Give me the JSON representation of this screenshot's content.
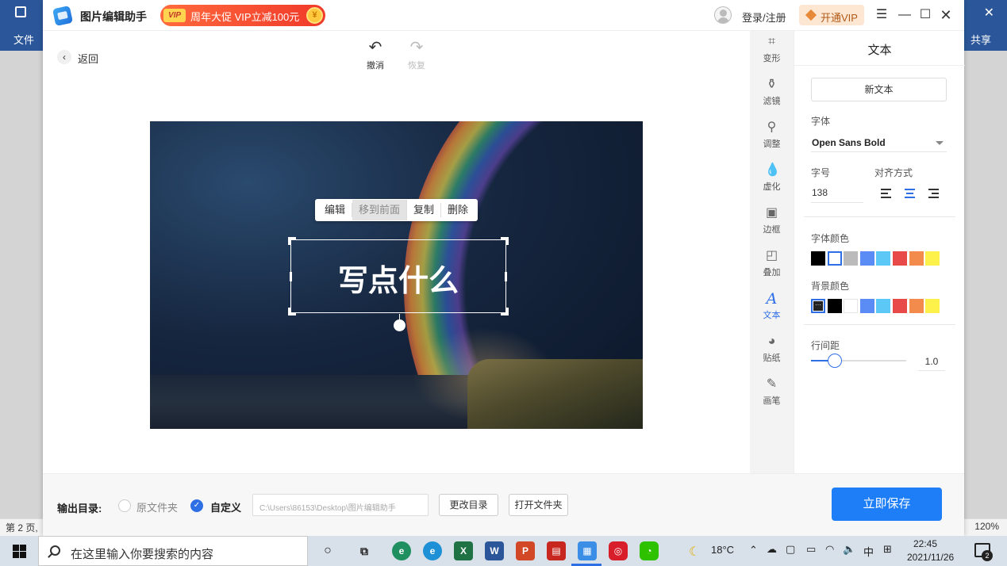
{
  "word": {
    "file_tab": "文件",
    "share_label": "共享",
    "page_status": "第 2 页,",
    "zoom": "120%"
  },
  "titlebar": {
    "app_title": "图片编辑助手",
    "promo_badge": "VIP",
    "promo_text": "周年大促 VIP立减100元",
    "login_label": "登录/注册",
    "vip_button_label": "开通VIP"
  },
  "toolbar": {
    "back_label": "返回",
    "undo_label": "撤消",
    "redo_label": "恢复"
  },
  "canvas": {
    "context_menu": [
      "编辑",
      "移到前面",
      "复制",
      "删除"
    ],
    "text_content": "写点什么"
  },
  "tools": [
    {
      "icon": "crop-icon",
      "label": "变形"
    },
    {
      "icon": "filter-icon",
      "label": "滤镜"
    },
    {
      "icon": "adjust-icon",
      "label": "调整"
    },
    {
      "icon": "blur-icon",
      "label": "虚化"
    },
    {
      "icon": "border-icon",
      "label": "边框"
    },
    {
      "icon": "overlay-icon",
      "label": "叠加"
    },
    {
      "icon": "text-icon",
      "label": "文本",
      "active": true
    },
    {
      "icon": "sticker-icon",
      "label": "贴纸"
    },
    {
      "icon": "brush-icon",
      "label": "画笔"
    }
  ],
  "props": {
    "title": "文本",
    "new_text_button": "新文本",
    "font_label": "字体",
    "font_value": "Open Sans Bold",
    "size_label": "字号",
    "size_value": "138",
    "align_label": "对齐方式",
    "font_color_label": "字体颜色",
    "font_colors": [
      "#000000",
      "#ffffff",
      "#bbbbbb",
      "#5b8cf5",
      "#5bc8f5",
      "#e84a4a",
      "#f28b4b",
      "#fef24a"
    ],
    "bg_color_label": "背景颜色",
    "bg_colors": [
      "#222222",
      "#000000",
      "#ffffff",
      "#5b8cf5",
      "#5bc8f5",
      "#e84a4a",
      "#f28b4b",
      "#fef24a"
    ],
    "line_spacing_label": "行间距",
    "line_spacing_value": "1.0"
  },
  "footer": {
    "output_label": "输出目录:",
    "original_folder_label": "原文件夹",
    "custom_label": "自定义",
    "path_placeholder": "C:\\Users\\86153\\Desktop\\图片编辑助手",
    "change_dir_button": "更改目录",
    "open_folder_button": "打开文件夹",
    "save_button": "立即保存"
  },
  "taskbar": {
    "search_placeholder": "在这里输入你要搜索的内容",
    "weather": "18°C",
    "ime_label": "中",
    "time": "22:45",
    "date": "2021/11/26",
    "notification_count": "2"
  }
}
